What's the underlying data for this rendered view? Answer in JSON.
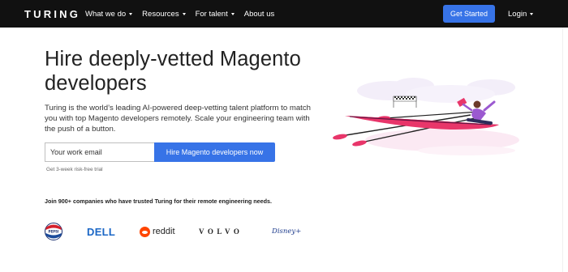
{
  "nav": {
    "logo": "TURING",
    "items": [
      {
        "label": "What we do",
        "dropdown": true
      },
      {
        "label": "Resources",
        "dropdown": true
      },
      {
        "label": "For talent",
        "dropdown": true
      },
      {
        "label": "About us",
        "dropdown": false
      }
    ],
    "get_started": "Get Started",
    "login": "Login"
  },
  "hero": {
    "title": "Hire deeply-vetted Magento developers",
    "description": "Turing is the world’s leading AI-powered deep-vetting talent platform to match you with top Magento developers remotely. Scale your engineering team with the push of a button.",
    "email_placeholder": "Your work email",
    "email_value": "",
    "cta": "Hire Magento developers now",
    "trial_note": "Get 3-week risk-free trial"
  },
  "trust": {
    "text": "Join 900+ companies who have trusted Turing for their remote engineering needs.",
    "logos": [
      {
        "name": "pepsi",
        "icon": "pepsi-logo"
      },
      {
        "name": "dell",
        "label": "DELL"
      },
      {
        "name": "reddit",
        "label": "reddit"
      },
      {
        "name": "volvo",
        "label": "VOLVO"
      },
      {
        "name": "disney",
        "label": "Disney+"
      }
    ]
  },
  "colors": {
    "nav_bg": "#111111",
    "accent": "#3773e7",
    "boat": "#e8366a",
    "rower_shirt": "#9b59d0"
  }
}
